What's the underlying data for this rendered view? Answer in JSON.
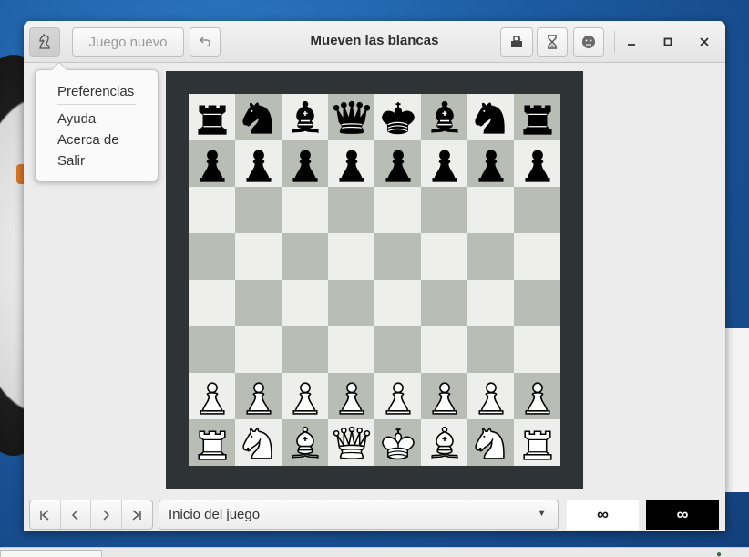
{
  "window": {
    "title": "Mueven las blancas",
    "new_game_label": "Juego nuevo"
  },
  "menu": {
    "items": [
      "Preferencias",
      "Ayuda",
      "Acerca de",
      "Salir"
    ]
  },
  "board": {
    "rows": [
      [
        "r",
        "n",
        "b",
        "q",
        "k",
        "b",
        "n",
        "r"
      ],
      [
        "p",
        "p",
        "p",
        "p",
        "p",
        "p",
        "p",
        "p"
      ],
      [
        "",
        "",
        "",
        "",
        "",
        "",
        "",
        ""
      ],
      [
        "",
        "",
        "",
        "",
        "",
        "",
        "",
        ""
      ],
      [
        "",
        "",
        "",
        "",
        "",
        "",
        "",
        ""
      ],
      [
        "",
        "",
        "",
        "",
        "",
        "",
        "",
        ""
      ],
      [
        "P",
        "P",
        "P",
        "P",
        "P",
        "P",
        "P",
        "P"
      ],
      [
        "R",
        "N",
        "B",
        "Q",
        "K",
        "B",
        "N",
        "R"
      ]
    ],
    "light_color": "#eeeeec",
    "dark_color": "#babdb6",
    "frame_color": "#2e3436"
  },
  "history": {
    "selected": "Inicio del juego"
  },
  "clocks": {
    "white": "∞",
    "black": "∞"
  },
  "icons": {
    "menu": "knight-menu-icon",
    "undo": "undo-icon",
    "save": "save-icon",
    "hourglass": "hourglass-icon",
    "resign": "resign-face-icon",
    "minimize": "minimize-icon",
    "maximize": "maximize-icon",
    "close": "close-icon",
    "first": "first-move-icon",
    "prev": "previous-move-icon",
    "next": "next-move-icon",
    "last": "last-move-icon"
  }
}
